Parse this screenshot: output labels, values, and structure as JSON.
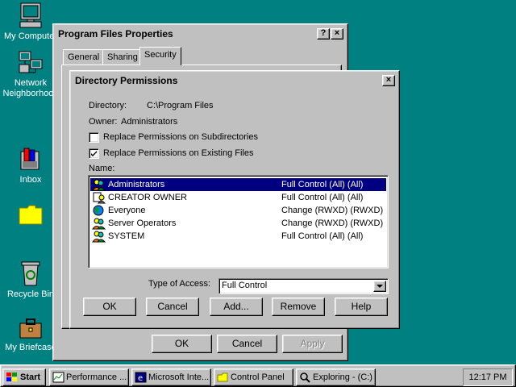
{
  "desktop": {
    "icons": [
      {
        "label": "My Computer",
        "icon": "computer-icon"
      },
      {
        "label": "Network Neighborhood",
        "icon": "network-icon"
      },
      {
        "label": "Inbox",
        "icon": "inbox-icon"
      },
      {
        "label": "",
        "icon": "folder-icon"
      },
      {
        "label": "Recycle Bin",
        "icon": "recycle-bin-icon"
      },
      {
        "label": "My Briefcase",
        "icon": "briefcase-icon"
      }
    ]
  },
  "props_window": {
    "title": "Program Files Properties",
    "help_btn": "?",
    "close_btn": "×",
    "tabs": [
      "General",
      "Sharing",
      "Security"
    ],
    "active_tab": "Security",
    "ok": "OK",
    "cancel": "Cancel",
    "apply": "Apply"
  },
  "perm_dialog": {
    "title": "Directory Permissions",
    "close_btn": "×",
    "directory_label": "Directory:",
    "directory_value": "C:\\Program Files",
    "owner_label": "Owner:",
    "owner_value": "Administrators",
    "replace_subdirs": {
      "label": "Replace Permissions on Subdirectories",
      "checked": false
    },
    "replace_files": {
      "label": "Replace Permissions on Existing Files",
      "checked": true
    },
    "name_label": "Name:",
    "entries": [
      {
        "name": "Administrators",
        "access": "Full Control (All) (All)",
        "icon": "group-icon",
        "selected": true
      },
      {
        "name": "CREATOR OWNER",
        "access": "Full Control (All) (All)",
        "icon": "creator-owner-icon",
        "selected": false
      },
      {
        "name": "Everyone",
        "access": "Change (RWXD) (RWXD)",
        "icon": "globe-icon",
        "selected": false
      },
      {
        "name": "Server Operators",
        "access": "Change (RWXD) (RWXD)",
        "icon": "group-icon",
        "selected": false
      },
      {
        "name": "SYSTEM",
        "access": "Full Control (All) (All)",
        "icon": "group-icon",
        "selected": false
      }
    ],
    "type_of_access_label": "Type of Access:",
    "type_of_access_value": "Full Control",
    "buttons": {
      "ok": "OK",
      "cancel": "Cancel",
      "add": "Add...",
      "remove": "Remove",
      "help": "Help"
    }
  },
  "taskbar": {
    "start": "Start",
    "tasks": [
      {
        "label": "Performance ...",
        "icon": "performance-icon"
      },
      {
        "label": "Microsoft Inte...",
        "icon": "internet-explorer-icon"
      },
      {
        "label": "Control Panel",
        "icon": "control-panel-icon"
      },
      {
        "label": "Exploring - (C:)",
        "icon": "explorer-icon"
      }
    ],
    "clock": "12:17 PM"
  },
  "colors": {
    "desktop": "#008080",
    "selection": "#000080",
    "face": "#c0c0c0"
  }
}
